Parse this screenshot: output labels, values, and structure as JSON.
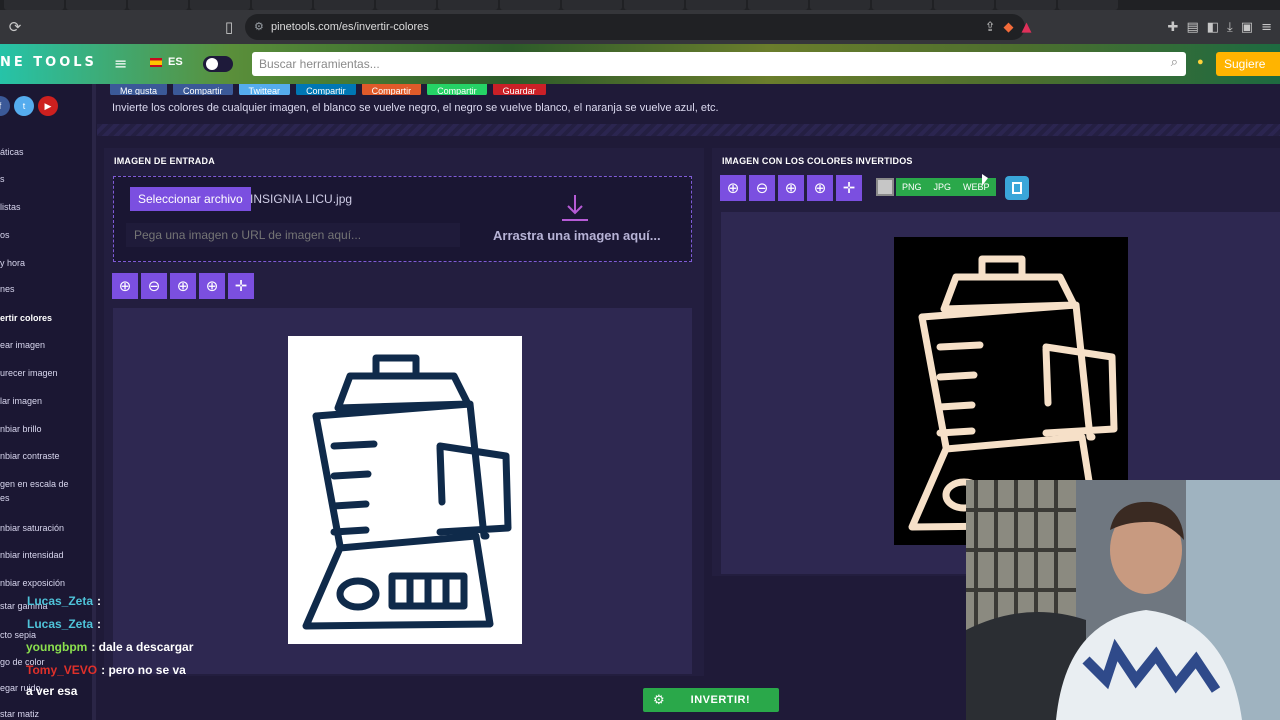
{
  "browser": {
    "url": "pinetools.com/es/invertir-colores"
  },
  "site": {
    "logo": "NE TOOLS",
    "lang": "ES",
    "search_placeholder": "Buscar herramientas...",
    "suggest_label": "Sugiere"
  },
  "share_buttons": [
    "Me gusta",
    "Compartir",
    "Twittear",
    "Compartir",
    "Compartir",
    "Compartir",
    "Guardar"
  ],
  "description": "Invierte los colores de cualquier imagen, el blanco se vuelve negro, el negro se vuelve blanco, el naranja se vuelve azul, etc.",
  "sidebar": {
    "items": [
      "áticas",
      "s",
      "listas",
      "os",
      "y hora",
      "nes",
      "ertir colores",
      "ear imagen",
      "urecer imagen",
      "lar imagen",
      "nbiar brillo",
      "nbiar contraste",
      "gen en escala de",
      "es",
      "nbiar saturación",
      "nbiar intensidad",
      "nbiar exposición",
      "star gamma",
      "cto sepia",
      "go de color",
      "egar ruido",
      "star matiz"
    ]
  },
  "input_panel": {
    "title": "IMAGEN DE ENTRADA",
    "select_button": "Seleccionar archivo",
    "file_name": "INSIGNIA LICU.jpg",
    "url_placeholder": "Pega una imagen o URL de imagen aquí...",
    "drag_text": "Arrastra una imagen aquí..."
  },
  "output_panel": {
    "title": "IMAGEN CON LOS COLORES INVERTIDOS",
    "formats": [
      "PNG",
      "JPG",
      "WEBP"
    ]
  },
  "invert_button": "INVERTIR!",
  "chat": [
    {
      "user": "Lucas_Zeta",
      "msg": ":",
      "color": "#4fc3d9"
    },
    {
      "user": "Lucas_Zeta",
      "msg": ":",
      "color": "#4fc3d9"
    },
    {
      "user": "youngbpm",
      "msg": ": dale a descargar",
      "color": "#8be04e"
    },
    {
      "user": "Tomy_VEVO",
      "msg": ": pero no se va",
      "color": "#e0302a"
    },
    {
      "user": "",
      "msg": "a ver esa",
      "color": "#ffffff"
    }
  ],
  "colors": {
    "accent": "#7b4fe0",
    "success": "#2aa84a",
    "background": "#1f1a38"
  }
}
